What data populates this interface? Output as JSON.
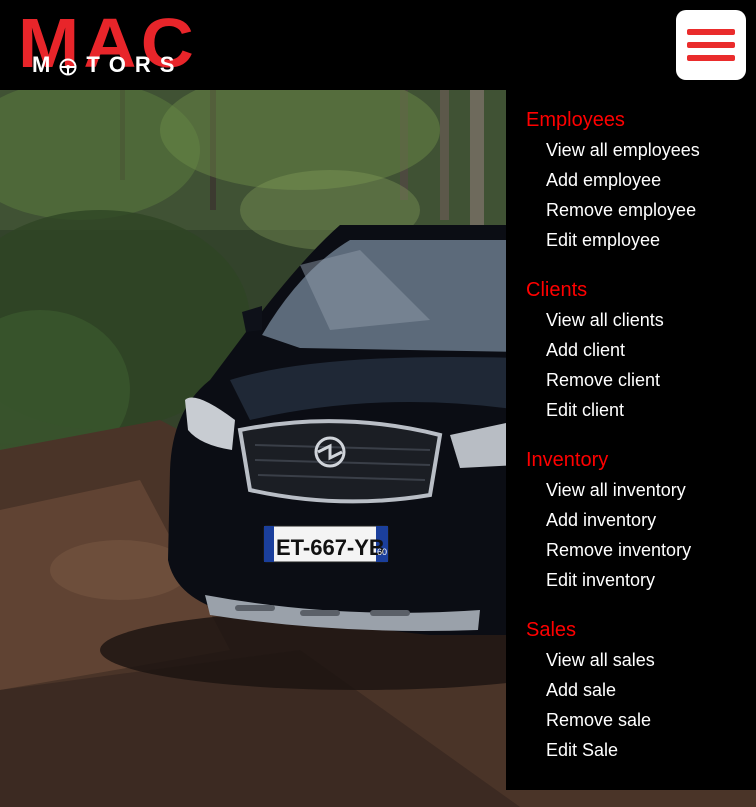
{
  "brand": {
    "logo_text": "MAC",
    "logo_subtext_letters": [
      "M",
      "T",
      "O",
      "R",
      "S"
    ],
    "logo_color": "#e8252a"
  },
  "header": {
    "menu_button_icon": "hamburger-menu-icon",
    "menu_button_color": "#ea2c2c"
  },
  "hero": {
    "license_plate": "ET-667-YB",
    "plate_region": "60"
  },
  "menu": {
    "heading_color": "#ff0000",
    "sections": [
      {
        "heading": "Employees",
        "items": [
          "View all employees",
          "Add employee",
          "Remove employee",
          "Edit employee"
        ]
      },
      {
        "heading": "Clients",
        "items": [
          "View all clients",
          "Add client",
          "Remove client",
          "Edit client"
        ]
      },
      {
        "heading": "Inventory",
        "items": [
          "View all inventory",
          "Add inventory",
          "Remove inventory",
          "Edit inventory"
        ]
      },
      {
        "heading": "Sales",
        "items": [
          "View all sales",
          "Add sale",
          "Remove sale",
          "Edit Sale"
        ]
      }
    ]
  }
}
